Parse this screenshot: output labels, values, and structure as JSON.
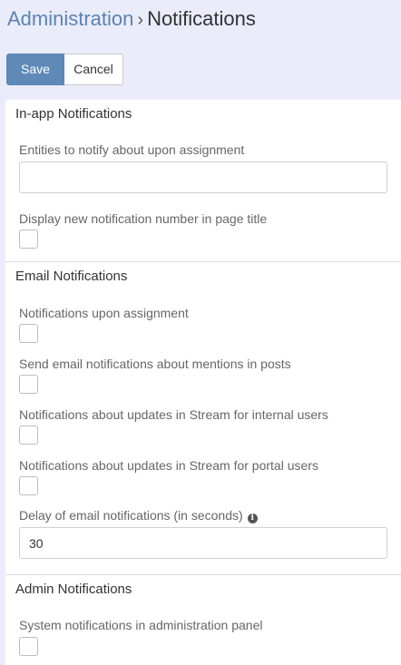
{
  "breadcrumb": {
    "parent": "Administration",
    "separator": "›",
    "current": "Notifications"
  },
  "buttons": {
    "save": "Save",
    "cancel": "Cancel"
  },
  "sections": {
    "in_app": {
      "title": "In-app Notifications",
      "entities_label": "Entities to notify about upon assignment",
      "entities_value": "",
      "display_number_label": "Display new notification number in page title"
    },
    "email": {
      "title": "Email Notifications",
      "assignment_label": "Notifications upon assignment",
      "mentions_label": "Send email notifications about mentions in posts",
      "stream_internal_label": "Notifications about updates in Stream for internal users",
      "stream_portal_label": "Notifications about updates in Stream for portal users",
      "delay_label": "Delay of email notifications (in seconds)",
      "delay_value": "30",
      "info_icon": "i"
    },
    "admin": {
      "title": "Admin Notifications",
      "system_label": "System notifications in administration panel"
    }
  },
  "colors": {
    "background": "#eaecfa",
    "link": "#5b83b4",
    "primary_button": "#5f8ab8"
  }
}
